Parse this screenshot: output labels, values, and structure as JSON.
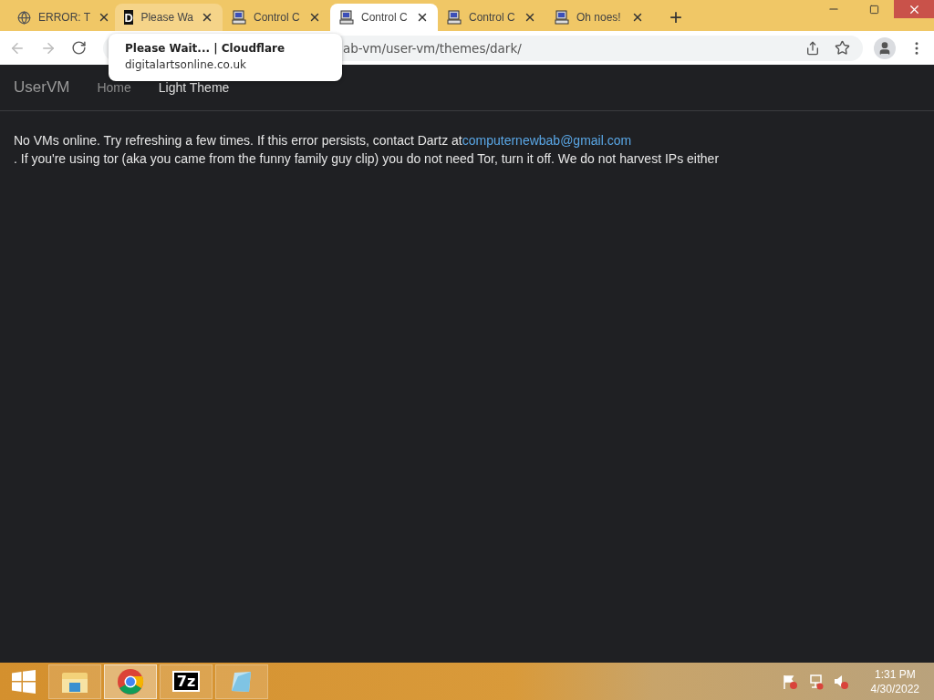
{
  "tabs": [
    {
      "title": "ERROR: T",
      "kind": "globe",
      "selected": false
    },
    {
      "title": "Please Wa",
      "kind": "letter",
      "icon_text": "D",
      "selected": false
    },
    {
      "title": "Control C",
      "kind": "computer",
      "selected": false
    },
    {
      "title": "Control C",
      "kind": "computer",
      "selected": true
    },
    {
      "title": "Control C",
      "kind": "computer",
      "selected": false
    },
    {
      "title": "Oh noes!",
      "kind": "computer",
      "selected": false
    }
  ],
  "new_tab": "+",
  "address_bar": {
    "url": "ab-vm/user-vm/themes/dark/"
  },
  "tooltip": {
    "title": "Please Wait... | Cloudflare",
    "domain": "digitalartsonline.co.uk"
  },
  "navbar": {
    "brand": "UserVM",
    "links": [
      {
        "label": "Home",
        "selected": false
      },
      {
        "label": "Light Theme",
        "selected": true
      }
    ]
  },
  "message": {
    "text": "No VMs online. Try refreshing a few times. If this error persists, contact Dartz at",
    "email": "computernewbab@gmail.com",
    "note": ". If you're using tor (aka you came from the funny family guy clip) you do not need Tor, turn it off. We do not harvest IPs either"
  },
  "taskbar": {
    "apps": [
      {
        "kind": "folder",
        "selected": false
      },
      {
        "kind": "chrome",
        "selected": true
      },
      {
        "kind": "sevenzip",
        "label": "7z",
        "selected": false
      },
      {
        "kind": "notepad",
        "selected": false
      }
    ],
    "tray": {
      "time": "1:31 PM",
      "date": "4/30/2022"
    }
  }
}
